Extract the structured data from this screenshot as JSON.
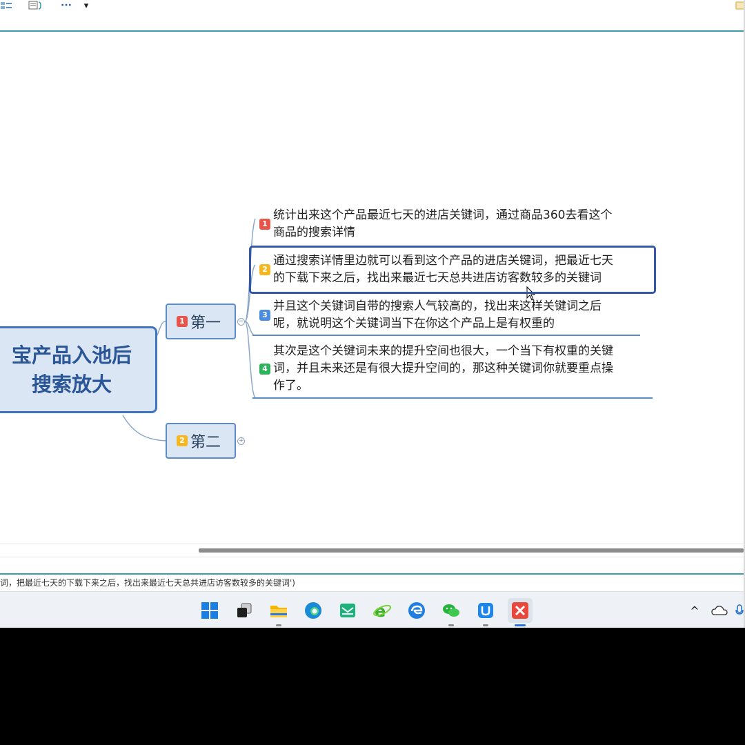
{
  "mindmap": {
    "central_topic": [
      "宝产品入池后",
      "搜索放大"
    ],
    "branches": [
      {
        "badge": "1",
        "label": "第一",
        "collapse_symbol": "−",
        "children": [
          {
            "badge": "1",
            "lines": [
              "统计出来这个产品最近七天的进店关键词，通过商品360去看这个",
              "商品的搜索详情"
            ]
          },
          {
            "badge": "2",
            "lines": [
              "通过搜索详情里边就可以看到这个产品的进店关键词，把最近七天",
              "的下载下来之后，找出来最近七天总共进店访客数较多的关键词"
            ],
            "selected": true
          },
          {
            "badge": "3",
            "lines": [
              "并且这个关键词自带的搜索人气较高的，找出来这样关键词之后",
              "呢，就说明这个关键词当下在你这个产品上是有权重的"
            ]
          },
          {
            "badge": "4",
            "lines": [
              "其次是这个关键词未来的提升空间也很大，一个当下有权重的关键",
              "词，并且未来还是有很大提升空间的，那这种关键词你就要重点操",
              "作了。"
            ]
          }
        ]
      },
      {
        "badge": "2",
        "label": "第二",
        "collapse_symbol": "+"
      }
    ]
  },
  "statusbar": {
    "text": "词，把最近七天的下载下来之后，找出来最近七天总共进店访客数较多的关键词')"
  },
  "toolbar": {
    "more_label": "···",
    "dropdown_label": "▾"
  },
  "taskbar": {
    "apps": [
      "windows-start",
      "task-view",
      "file-explorer",
      "edge",
      "mail",
      "ie-green",
      "edge-legacy",
      "wechat",
      "qianniu",
      "xmind"
    ],
    "tray": {
      "chevron": "^"
    }
  },
  "colors": {
    "accent": "#3e74c0",
    "branch_fill": "#dae6f4",
    "badge_red": "#e6544a",
    "badge_yellow": "#f5b823",
    "badge_blue": "#4a8de0",
    "badge_green": "#2db35c"
  }
}
